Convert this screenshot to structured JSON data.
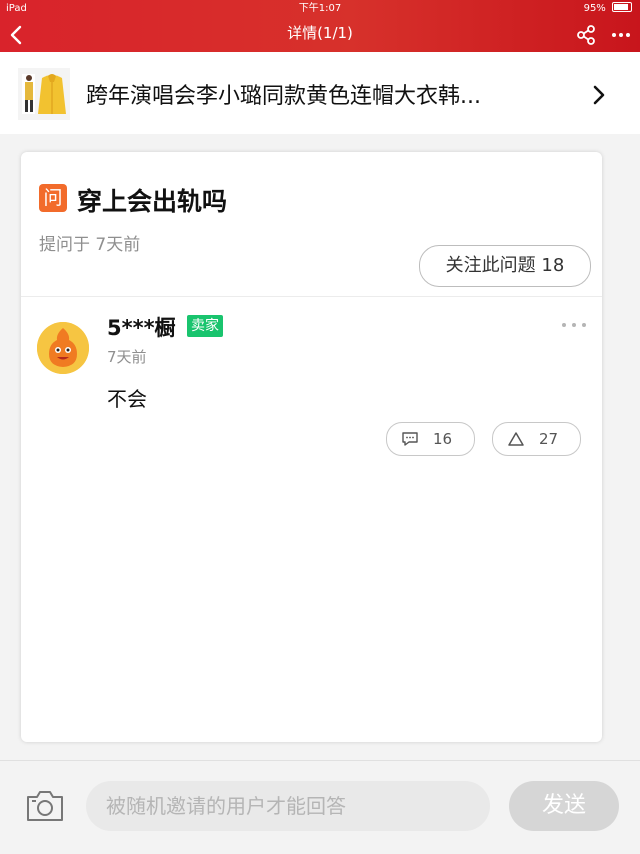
{
  "status_bar": {
    "device": "iPad",
    "time": "下午1:07",
    "battery": "95%"
  },
  "nav": {
    "title": "详情(1/1)",
    "icons": [
      "back-icon",
      "share-icon",
      "more-icon"
    ]
  },
  "product": {
    "title": "跨年演唱会李小璐同款黄色连帽大衣韩..."
  },
  "question": {
    "icon_text": "问",
    "text": "穿上会出轨吗",
    "asked_time": "提问于 7天前",
    "follow_label": "关注此问题 18"
  },
  "answer": {
    "user": "5***橱",
    "badge": "卖家",
    "time": "7天前",
    "text": "不会",
    "comment_count": "16",
    "like_count": "27"
  },
  "composer": {
    "placeholder": "被随机邀请的用户才能回答",
    "send_label": "发送"
  },
  "colors": {
    "brand_red": "#d7312b",
    "question_orange": "#f26b2b",
    "seller_green": "#19c46e"
  }
}
